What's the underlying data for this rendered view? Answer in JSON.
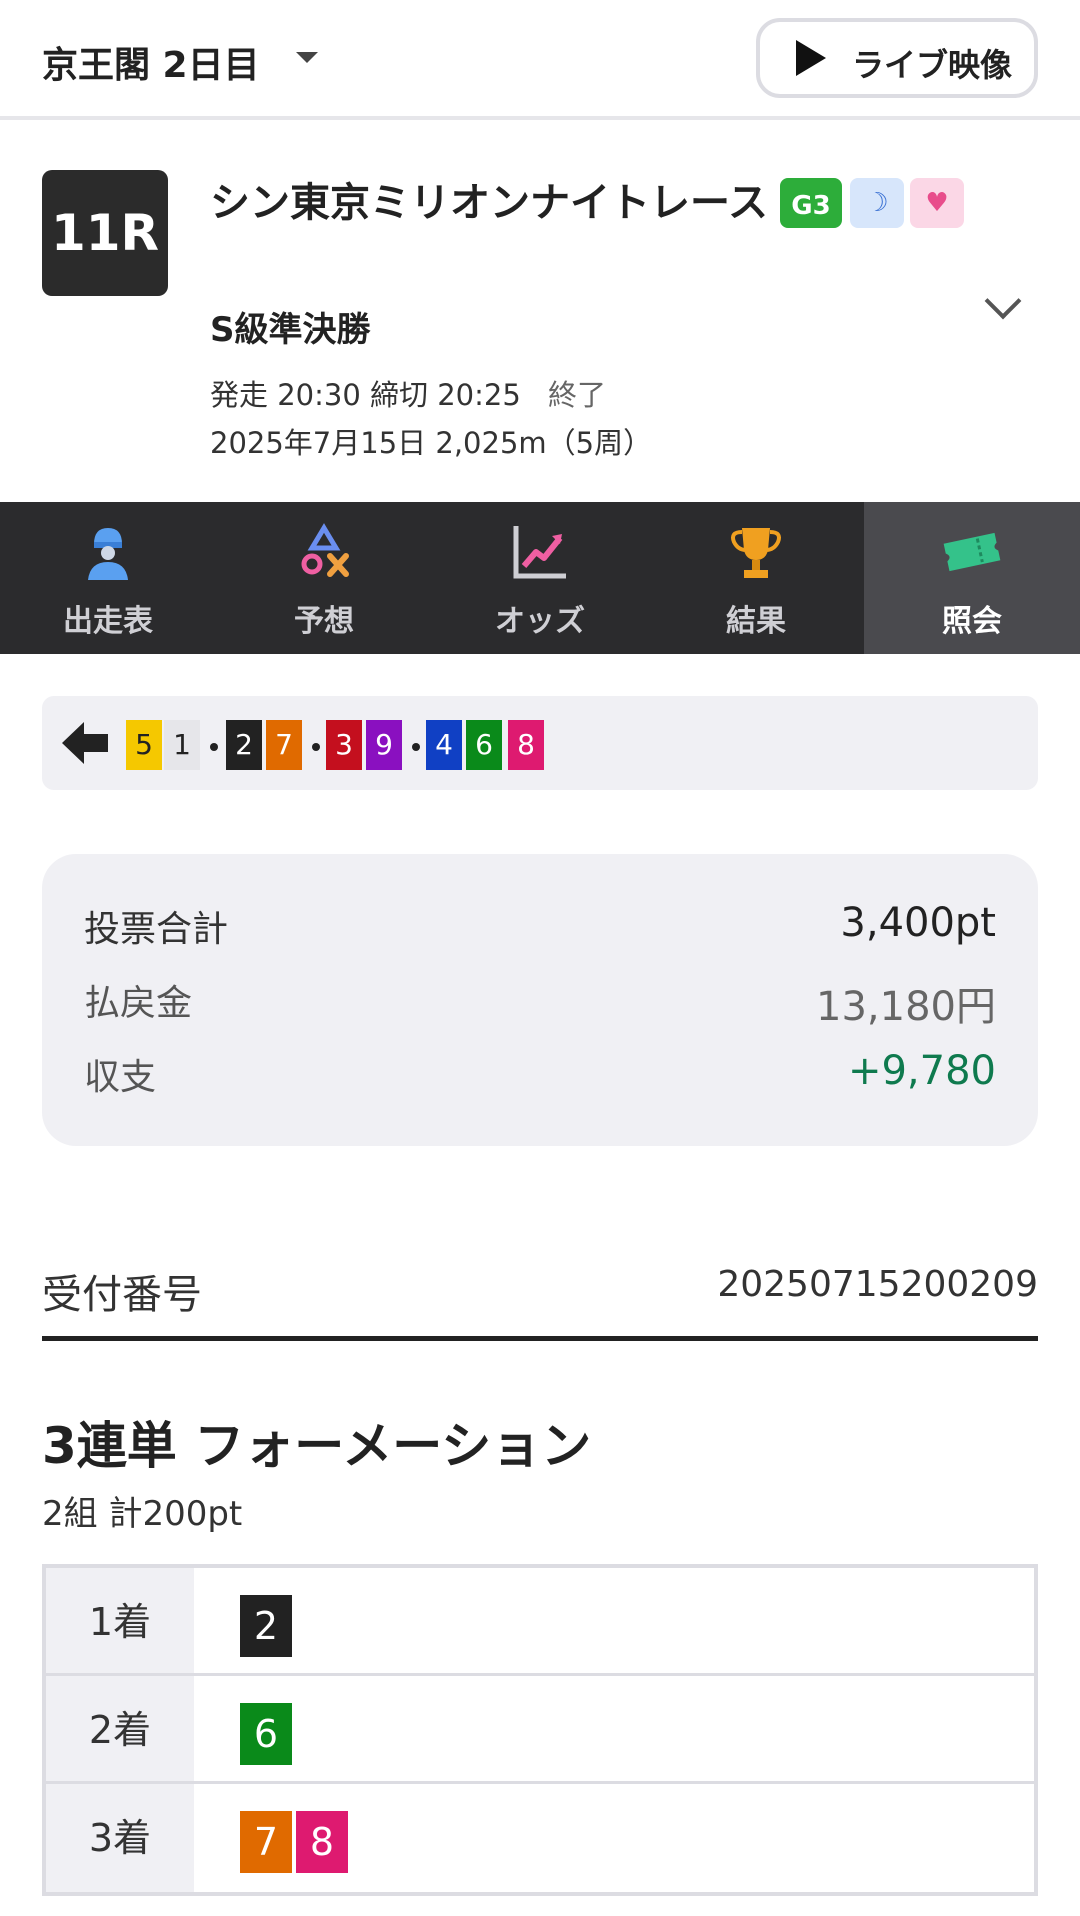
{
  "header": {
    "venue": "京王閣 2日目",
    "live_label": "ライブ映像"
  },
  "race": {
    "number": "11R",
    "name": "シン東京ミリオンナイトレース",
    "grade_badge": "G3",
    "race_class": "S級準決勝",
    "start_time": "発走 20:30",
    "close_time": "締切 20:25",
    "status": "終了",
    "date_distance": "2025年7月15日 2,025m（5周）"
  },
  "tabs": [
    {
      "label": "出走表",
      "icon": "rider-icon",
      "active": false
    },
    {
      "label": "予想",
      "icon": "prediction-icon",
      "active": false
    },
    {
      "label": "オッズ",
      "icon": "odds-chart-icon",
      "active": false
    },
    {
      "label": "結果",
      "icon": "trophy-icon",
      "active": false
    },
    {
      "label": "照会",
      "icon": "ticket-icon",
      "active": true
    }
  ],
  "combination": {
    "numbers": [
      "5",
      "1",
      "2",
      "7",
      "3",
      "9",
      "4",
      "6",
      "8"
    ],
    "groups": [
      [
        "5",
        "1"
      ],
      [
        "2",
        "7"
      ],
      [
        "3",
        "9"
      ],
      [
        "4",
        "6",
        "8"
      ]
    ]
  },
  "summary": {
    "total_label": "投票合計",
    "total_value": "3,400pt",
    "payout_label": "払戻金",
    "payout_value": "13,180円",
    "balance_label": "収支",
    "balance_value": "+9,780"
  },
  "receipt": {
    "label": "受付番号",
    "number": "20250715200209"
  },
  "bet": {
    "title": "3連単 フォーメーション",
    "subtitle": "2組 計200pt",
    "rows": [
      {
        "position": "1着",
        "numbers": [
          "2"
        ]
      },
      {
        "position": "2着",
        "numbers": [
          "6"
        ]
      },
      {
        "position": "3着",
        "numbers": [
          "7",
          "8"
        ]
      }
    ]
  },
  "colors": {
    "1": "#e6e6ea",
    "2": "#222222",
    "3": "#c40f1e",
    "4": "#1040c4",
    "5": "#f5c800",
    "6": "#0a8a1a",
    "7": "#e06a00",
    "8": "#de1a70",
    "9": "#8a10c0",
    "positive": "#0f7a4e"
  }
}
